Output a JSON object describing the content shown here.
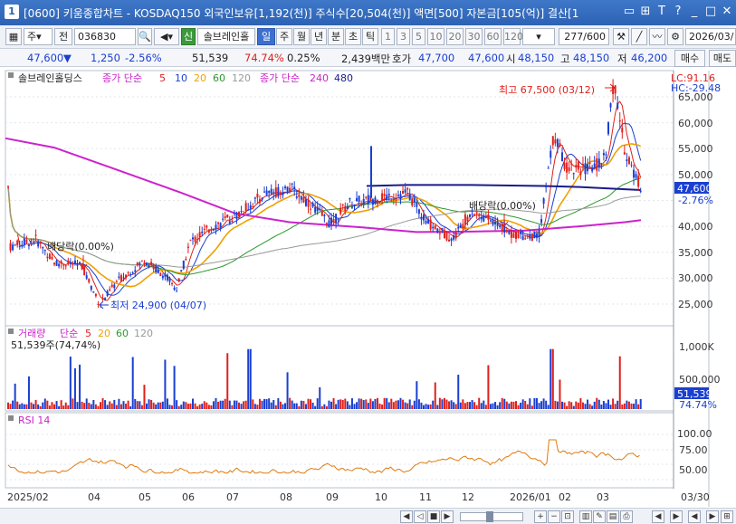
{
  "window": {
    "title": "[0600] 키움종합차트 - KOSDAQ150 외국인보유[1,192(천)] 주식수[20,504(천)] 액면[500] 자본금[105(억)] 결산[1",
    "icon": "1"
  },
  "toolbar": {
    "period_select": "주",
    "prev_label": "전",
    "code": "036830",
    "sin_badge": "신",
    "stock_name": "솔브레인홀",
    "periods": [
      "일",
      "주",
      "월",
      "년",
      "분",
      "초",
      "틱"
    ],
    "active_period": "일",
    "numbers": [
      "1",
      "3",
      "5",
      "10",
      "20",
      "30",
      "60",
      "120"
    ],
    "bar_count": "277",
    "bar_total": "/600",
    "date": "2026/03/",
    "buy": "매수",
    "sell": "매도"
  },
  "quote": {
    "price": "47,600",
    "down_arrow": "▼",
    "change": "1,250",
    "change_pct": "-2.56%",
    "volume": "51,539",
    "vol_ratio": "74.74%",
    "turnover": "0.25%",
    "amount": "2,439백만",
    "bid_label": "호가",
    "bid": "47,700",
    "ask": "47,600",
    "open_label": "시",
    "open": "48,150",
    "high_label": "고",
    "high": "48,150",
    "low_label": "저",
    "low": "46,200"
  },
  "legend": {
    "name": "솔브레인홀딩스",
    "ma_label": "종가 단순",
    "ma": [
      "5",
      "10",
      "20",
      "60",
      "120"
    ],
    "ma_long_label": "종가 단순",
    "ma_long": [
      "240",
      "480"
    ],
    "lc": "LC:91.16",
    "hc": "HC:-29.48"
  },
  "annotations": {
    "high": "최고 67,500 (03/12)",
    "low": "최저 24,900 (04/07)",
    "dividend1": "배당락(0.00%)",
    "dividend2": "배당락(0.00%)"
  },
  "price_axis": {
    "ticks": [
      "65,000",
      "60,000",
      "55,000",
      "50,000",
      "40,000",
      "35,000",
      "30,000",
      "25,000"
    ],
    "current": "47,600",
    "current_pct": "-2.76%"
  },
  "volume_panel": {
    "label": "거래량",
    "ma_label": "단순",
    "ma": [
      "5",
      "20",
      "60",
      "120"
    ],
    "current": "51,539주(74,74%)",
    "ticks": [
      "1,000K",
      "500,000"
    ],
    "current_value": "51,539",
    "current_pct": "74.74%"
  },
  "rsi_panel": {
    "label": "RSI 14",
    "ticks": [
      "100.00",
      "75.00",
      "50.00"
    ]
  },
  "time_axis": [
    "2025/02",
    "04",
    "05",
    "06",
    "07",
    "08",
    "09",
    "10",
    "11",
    "12",
    "2026/01",
    "02",
    "03",
    "03/30"
  ],
  "colors": {
    "up": "#e0201b",
    "down": "#1a3fd1",
    "ma5": "#e0201b",
    "ma10": "#1a3fd1",
    "ma20": "#f0a000",
    "ma60": "#2a9a2a",
    "ma120": "#999999",
    "ma240": "#cc22cc",
    "ma480": "#1a1a8a",
    "rsi": "#e07a10"
  }
}
